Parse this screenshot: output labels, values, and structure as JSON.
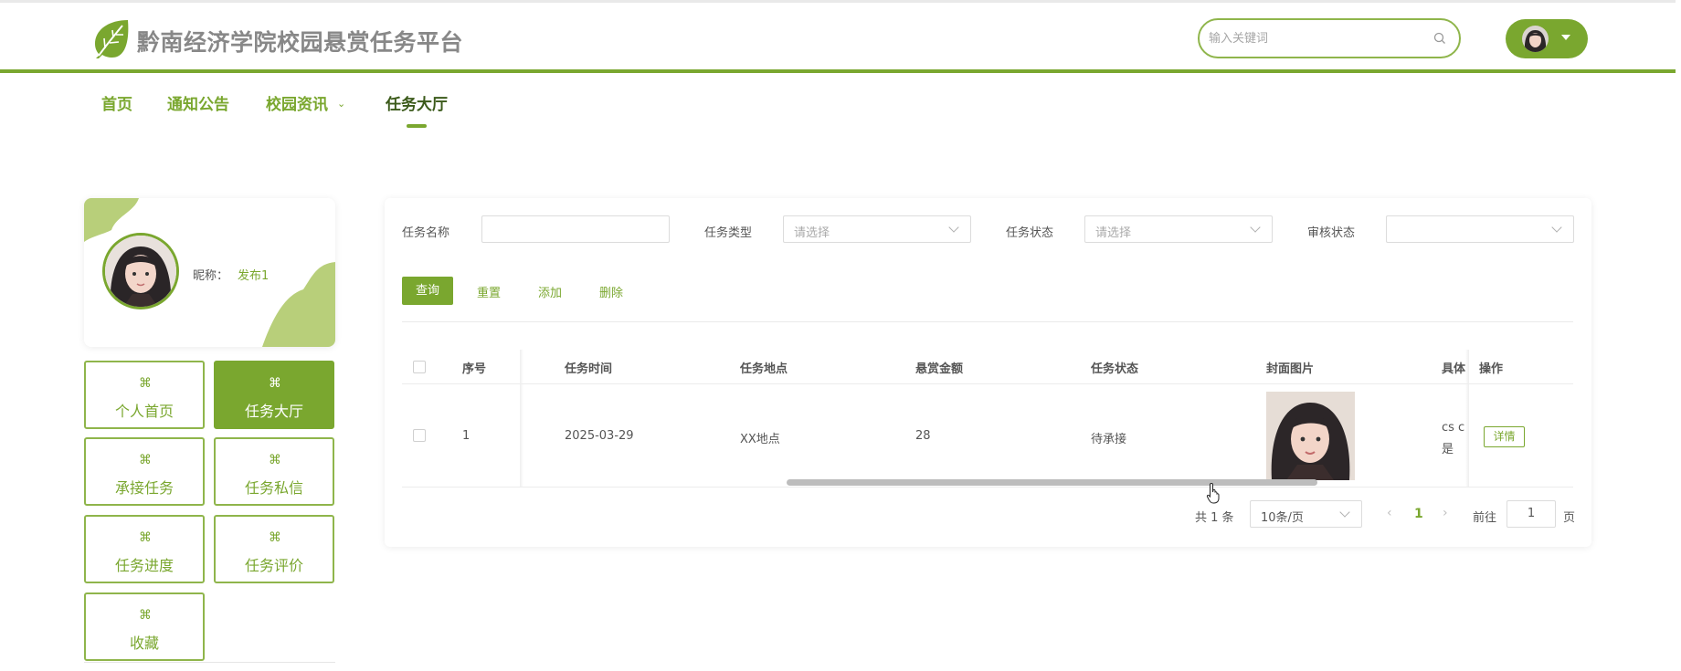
{
  "header": {
    "site_title": "黔南经济学院校园悬赏任务平台",
    "search_placeholder": "输入关键词",
    "logo_icon": "leaf-icon",
    "brand_color": "#7aa72f"
  },
  "nav": {
    "items": [
      {
        "label": "首页"
      },
      {
        "label": "通知公告"
      },
      {
        "label": "校园资讯"
      },
      {
        "label": "任务大厅"
      }
    ],
    "active": "任务大厅"
  },
  "profile": {
    "nick_label": "昵称：",
    "nick_value": "发布1"
  },
  "sidebar_menu": [
    {
      "label": "个人首页",
      "icon": "clover-icon"
    },
    {
      "label": "任务大厅",
      "icon": "clover-icon",
      "active": true
    },
    {
      "label": "承接任务",
      "icon": "clover-icon"
    },
    {
      "label": "任务私信",
      "icon": "clover-icon"
    },
    {
      "label": "任务进度",
      "icon": "clover-icon"
    },
    {
      "label": "任务评价",
      "icon": "clover-icon"
    },
    {
      "label": "收藏",
      "icon": "clover-icon"
    }
  ],
  "filters": {
    "task_name_label": "任务名称",
    "task_type_label": "任务类型",
    "task_type_placeholder": "请选择",
    "task_status_label": "任务状态",
    "task_status_placeholder": "请选择",
    "audit_status_label": "审核状态"
  },
  "actions": {
    "query": "查询",
    "reset": "重置",
    "add": "添加",
    "delete": "删除"
  },
  "table": {
    "columns": [
      "序号",
      "任务时间",
      "任务地点",
      "悬赏金额",
      "任务状态",
      "封面图片",
      "具体",
      "操作"
    ],
    "rows": [
      {
        "index": "1",
        "time": "2025-03-29",
        "location": "XX地点",
        "reward": "28",
        "status": "待承接",
        "detail_line1": "cs c",
        "detail_line2": "是",
        "action": "详情"
      }
    ]
  },
  "pagination": {
    "total": "共 1 条",
    "page_size": "10条/页",
    "prev": "‹",
    "current": "1",
    "next": "›",
    "goto_label": "前往",
    "goto_value": "1",
    "goto_unit": "页"
  }
}
